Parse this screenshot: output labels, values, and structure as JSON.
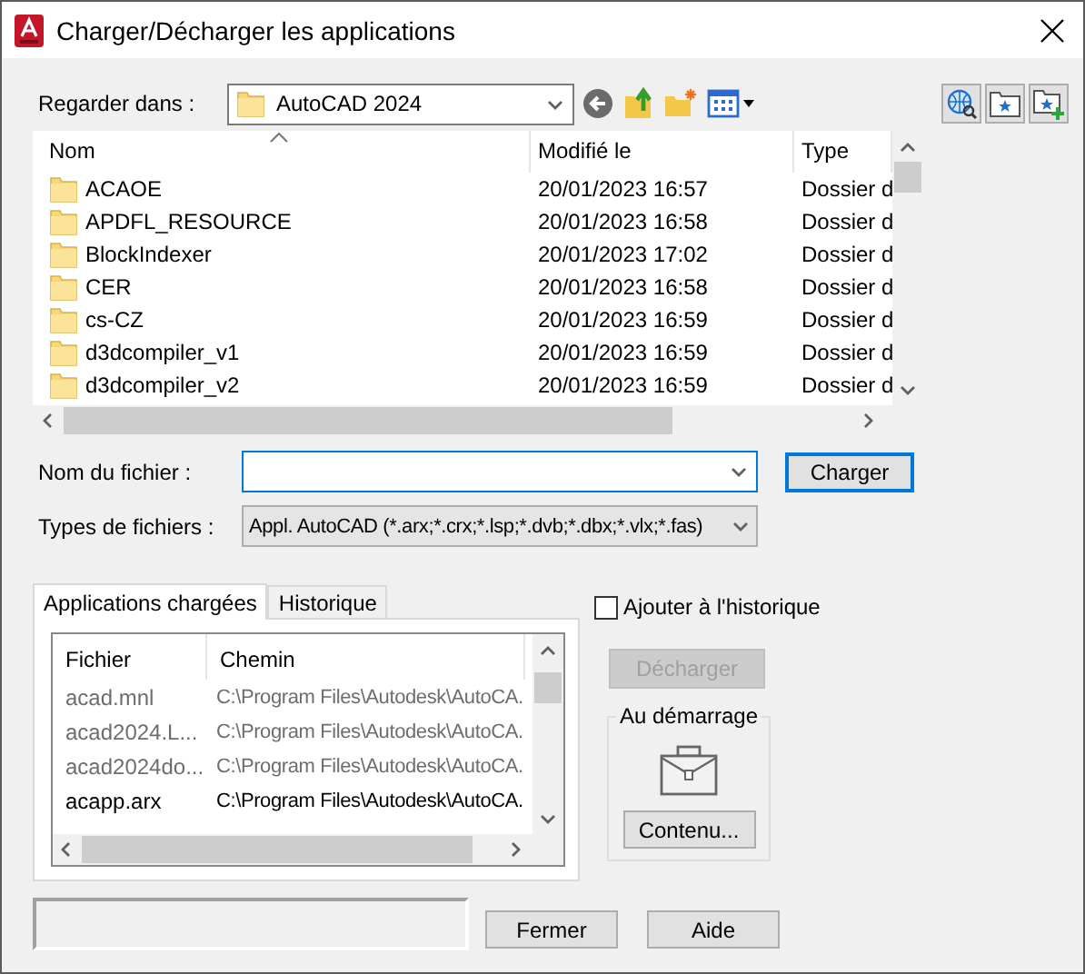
{
  "window": {
    "title": "Charger/Décharger les applications"
  },
  "look_in": {
    "label": "Regarder dans :",
    "value": "AutoCAD 2024"
  },
  "file_list": {
    "columns": [
      "Nom",
      "Modifié le",
      "Type"
    ],
    "rows": [
      {
        "name": "ACAOE",
        "modified": "20/01/2023 16:57",
        "type": "Dossier d"
      },
      {
        "name": "APDFL_RESOURCE",
        "modified": "20/01/2023 16:58",
        "type": "Dossier d"
      },
      {
        "name": "BlockIndexer",
        "modified": "20/01/2023 17:02",
        "type": "Dossier d"
      },
      {
        "name": "CER",
        "modified": "20/01/2023 16:58",
        "type": "Dossier d"
      },
      {
        "name": "cs-CZ",
        "modified": "20/01/2023 16:59",
        "type": "Dossier d"
      },
      {
        "name": "d3dcompiler_v1",
        "modified": "20/01/2023 16:59",
        "type": "Dossier d"
      },
      {
        "name": "d3dcompiler_v2",
        "modified": "20/01/2023 16:59",
        "type": "Dossier d"
      }
    ]
  },
  "file_name": {
    "label": "Nom du fichier :"
  },
  "load_button": "Charger",
  "file_types": {
    "label": "Types de fichiers :",
    "value": "Appl. AutoCAD (*.arx;*.crx;*.lsp;*.dvb;*.dbx;*.vlx;*.fas)"
  },
  "tabs": [
    {
      "label": "Applications chargées",
      "selected": true
    },
    {
      "label": "Historique",
      "selected": false
    }
  ],
  "loaded_apps": {
    "columns": [
      "Fichier",
      "Chemin"
    ],
    "rows": [
      {
        "file": "acad.mnl",
        "path": "C:\\Program Files\\Autodesk\\AutoCA.",
        "dimmed": true
      },
      {
        "file": "acad2024.L...",
        "path": "C:\\Program Files\\Autodesk\\AutoCA.",
        "dimmed": true
      },
      {
        "file": "acad2024do...",
        "path": "C:\\Program Files\\Autodesk\\AutoCA.",
        "dimmed": true
      },
      {
        "file": "acapp.arx",
        "path": "C:\\Program Files\\Autodesk\\AutoCA.",
        "dimmed": false
      }
    ]
  },
  "add_to_history": {
    "label": "Ajouter à l'historique",
    "checked": false
  },
  "unload_button": {
    "label": "Décharger",
    "disabled": true
  },
  "startup": {
    "title": "Au démarrage",
    "button": "Contenu..."
  },
  "buttons": [
    "Fermer",
    "Aide"
  ]
}
